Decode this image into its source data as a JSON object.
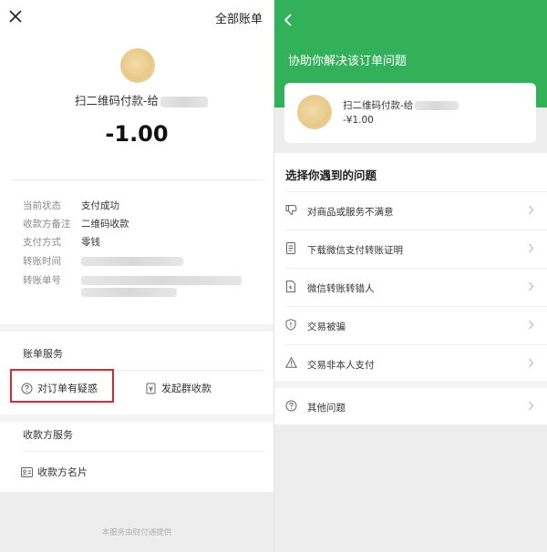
{
  "left": {
    "top_right_label": "全部账单",
    "merchant_name": "扫二维码付款-给",
    "amount": "-1.00",
    "details": [
      {
        "key": "当前状态",
        "value": "支付成功"
      },
      {
        "key": "收款方备注",
        "value": "二维码收款"
      },
      {
        "key": "支付方式",
        "value": "零钱"
      },
      {
        "key": "转账时间",
        "value": ""
      },
      {
        "key": "转账单号",
        "value": ""
      }
    ],
    "bill_service_title": "账单服务",
    "order_question_label": "对订单有疑惑",
    "group_collect_label": "发起群收款",
    "payee_service_title": "收款方服务",
    "payee_card_label": "收款方名片",
    "footer_text": "本服务由财付通提供"
  },
  "right": {
    "header_title": "协助你解决该订单问题",
    "merchant_name": "扫二维码付款-给",
    "amount": "-¥1.00",
    "question_title": "选择你遇到的问题",
    "questions": [
      {
        "label": "对商品或服务不满意",
        "icon": "thumb-down-icon"
      },
      {
        "label": "下载微信支付转账证明",
        "icon": "document-icon"
      },
      {
        "label": "微信转账转错人",
        "icon": "transfer-doc-icon"
      },
      {
        "label": "交易被骗",
        "icon": "shield-alert-icon"
      },
      {
        "label": "交易非本人支付",
        "icon": "warning-icon"
      },
      {
        "label": "其他问题",
        "icon": "question-icon"
      }
    ]
  },
  "colors": {
    "wechat_green": "#33b15a",
    "highlight_red": "#d9282f"
  }
}
